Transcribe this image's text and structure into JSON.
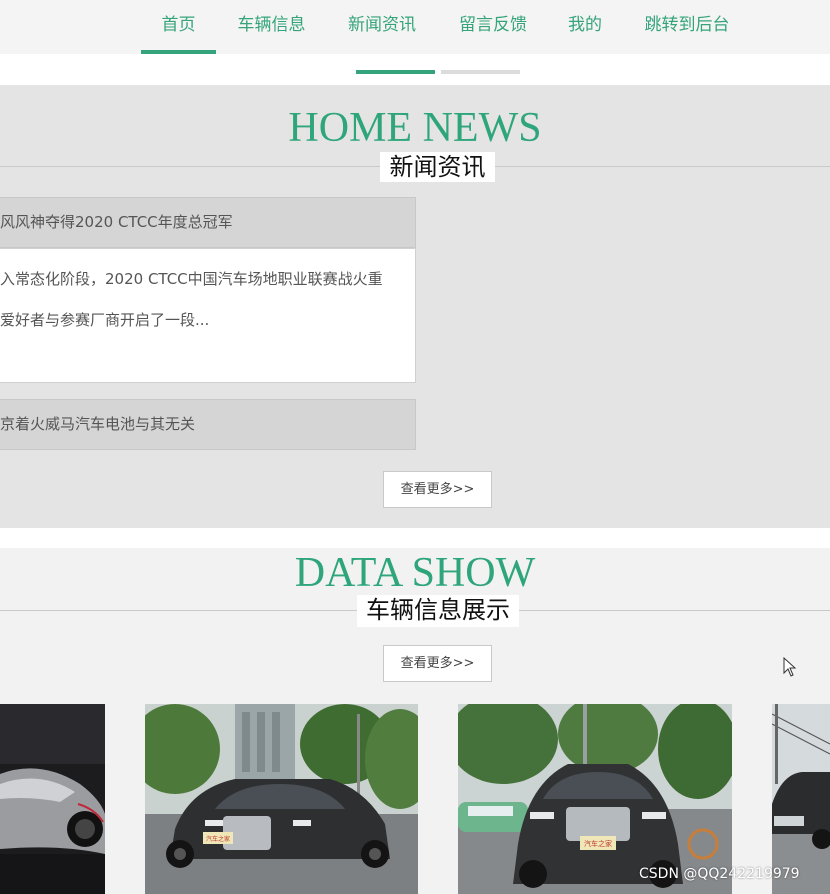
{
  "nav": {
    "items": [
      {
        "label": "首页",
        "active": true
      },
      {
        "label": "车辆信息",
        "active": false
      },
      {
        "label": "新闻资讯",
        "active": false
      },
      {
        "label": "留言反馈",
        "active": false
      },
      {
        "label": "我的",
        "active": false
      },
      {
        "label": "跳转到后台",
        "active": false
      }
    ]
  },
  "carousel": {
    "active_color": "#35a47c",
    "inactive_color": "#dcdcdc"
  },
  "news": {
    "title_en": "HOME NEWS",
    "title_cn": "新闻资讯",
    "items": [
      {
        "title": "风风神夺得2020 CTCC年度总冠军"
      },
      {
        "title": "京着火威马汽车电池与其无关"
      }
    ],
    "excerpt_line1": "入常态化阶段，2020 CTCC中国汽车场地职业联赛战火重",
    "excerpt_line2": "爱好者与参赛厂商开启了一段...",
    "more_label": "查看更多>>"
  },
  "data_show": {
    "title_en": "DATA SHOW",
    "title_cn": "车辆信息展示",
    "more_label": "查看更多>>",
    "cars": [
      {
        "icon": "concept-car-image"
      },
      {
        "icon": "bmw-sedan-image",
        "plate": "汽车之家"
      },
      {
        "icon": "bmw-sedan-image",
        "plate": "汽车之家"
      },
      {
        "icon": "electric-car-image"
      }
    ]
  },
  "watermark": "CSDN @QQ242219979",
  "colors": {
    "accent": "#35a47c"
  }
}
